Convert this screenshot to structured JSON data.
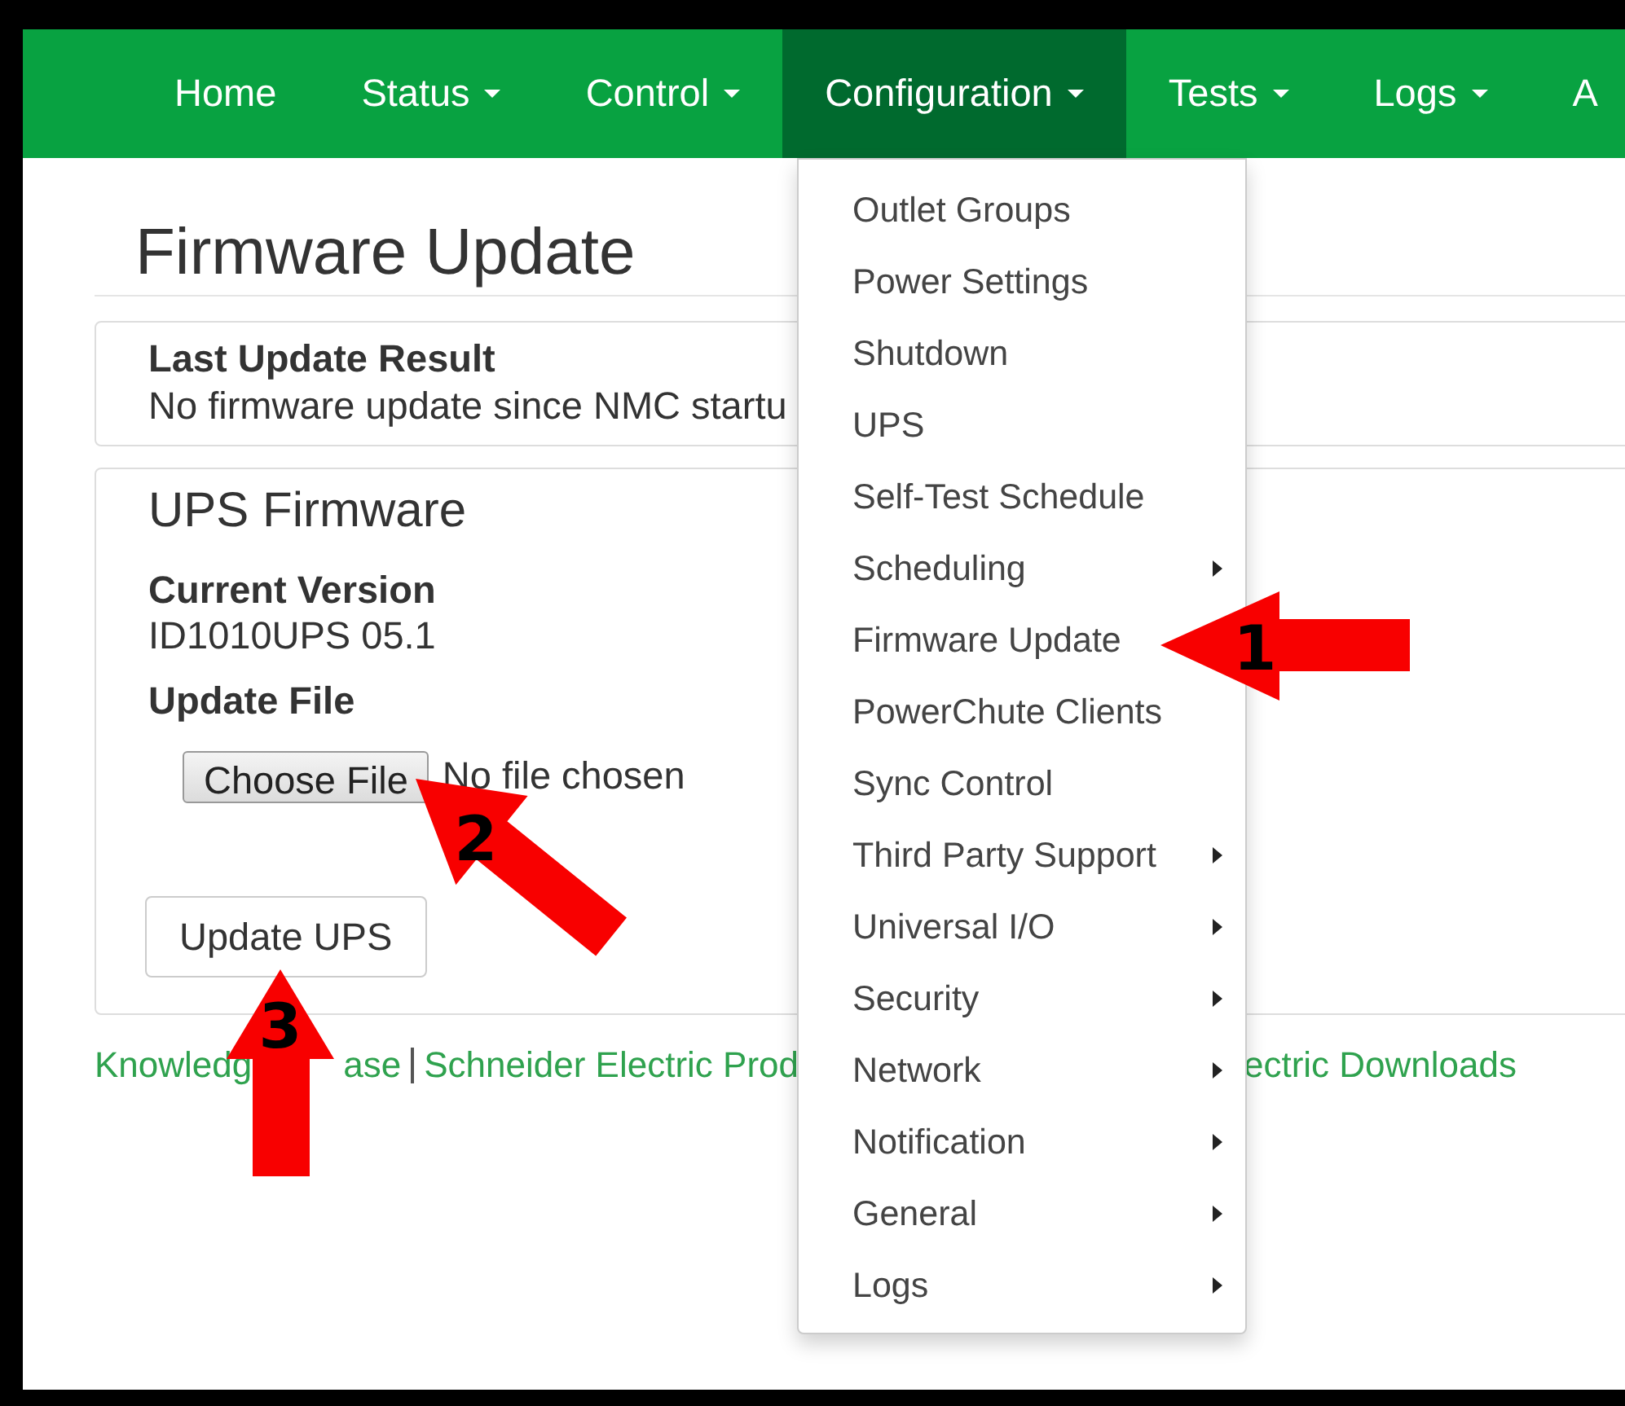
{
  "nav": [
    {
      "label": "Home",
      "has_caret": false,
      "selected": false
    },
    {
      "label": "Status",
      "has_caret": true,
      "selected": false
    },
    {
      "label": "Control",
      "has_caret": true,
      "selected": false
    },
    {
      "label": "Configuration",
      "has_caret": true,
      "selected": true
    },
    {
      "label": "Tests",
      "has_caret": true,
      "selected": false
    },
    {
      "label": "Logs",
      "has_caret": true,
      "selected": false
    },
    {
      "label": "A",
      "has_caret": false,
      "selected": false
    }
  ],
  "page_title": "Firmware Update",
  "last_update": {
    "heading": "Last Update Result",
    "text": "No firmware update since NMC startu"
  },
  "ups_firmware": {
    "heading": "UPS Firmware",
    "version_label": "Current Version",
    "version": "ID1010UPS 05.1",
    "file_label": "Update File",
    "choose_button": "Choose File",
    "file_status": "No file chosen",
    "submit_button": "Update UPS"
  },
  "footer_links": [
    {
      "label": "Knowledg",
      "separator_before": false
    },
    {
      "label": "ase",
      "separator_before": false
    },
    {
      "label": "Schneider Electric Prod",
      "separator_before": true
    },
    {
      "label": "ectric Downloads",
      "separator_before": false
    }
  ],
  "menu": [
    {
      "label": "Outlet Groups",
      "has_submenu": false
    },
    {
      "label": "Power Settings",
      "has_submenu": false
    },
    {
      "label": "Shutdown",
      "has_submenu": false
    },
    {
      "label": "UPS",
      "has_submenu": false
    },
    {
      "label": "Self-Test Schedule",
      "has_submenu": false
    },
    {
      "label": "Scheduling",
      "has_submenu": true
    },
    {
      "label": "Firmware Update",
      "has_submenu": false
    },
    {
      "label": "PowerChute Clients",
      "has_submenu": false
    },
    {
      "label": "Sync Control",
      "has_submenu": false
    },
    {
      "label": "Third Party Support",
      "has_submenu": true
    },
    {
      "label": "Universal I/O",
      "has_submenu": true
    },
    {
      "label": "Security",
      "has_submenu": true
    },
    {
      "label": "Network",
      "has_submenu": true
    },
    {
      "label": "Notification",
      "has_submenu": true
    },
    {
      "label": "General",
      "has_submenu": true
    },
    {
      "label": "Logs",
      "has_submenu": true
    }
  ],
  "annotations": [
    {
      "label": "1"
    },
    {
      "label": "2"
    },
    {
      "label": "3"
    }
  ]
}
